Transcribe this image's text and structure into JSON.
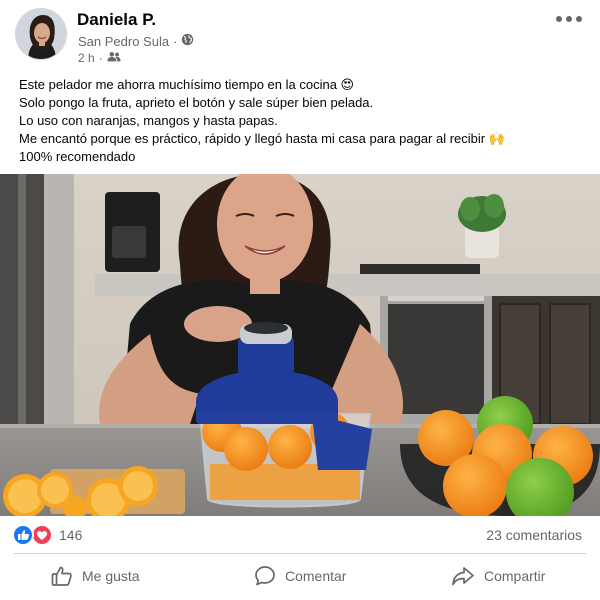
{
  "post": {
    "author": "Daniela P.",
    "location": "San Pedro Sula",
    "separator": "·",
    "time": "2 h",
    "lines": [
      "Este pelador me ahorra muchísimo tiempo en la cocina 😍",
      "Solo pongo la fruta, aprieto el botón y sale súper bien pelada.",
      "Lo uso con naranjas, mangos y hasta papas.",
      "Me encantó porque es práctico, rápido y llegó hasta mi casa para pagar al recibir 🙌",
      "100% recomendado"
    ]
  },
  "stats": {
    "reaction_count": "146",
    "comments": "23 comentarios"
  },
  "actions": {
    "like": "Me gusta",
    "comment": "Comentar",
    "share": "Compartir"
  },
  "colors": {
    "like_blue": "#1877f2",
    "love_red": "#f33e58",
    "meta_gray": "#65676b",
    "appliance_blue": "#1f3c9a"
  },
  "icons": {
    "globe": "globe-icon",
    "friends": "friends-icon",
    "more": "more-options-icon",
    "like_reaction": "like-reaction-icon",
    "love_reaction": "love-reaction-icon",
    "like_action": "thumbs-up-icon",
    "comment_action": "speech-bubble-icon",
    "share_action": "share-arrow-icon"
  }
}
